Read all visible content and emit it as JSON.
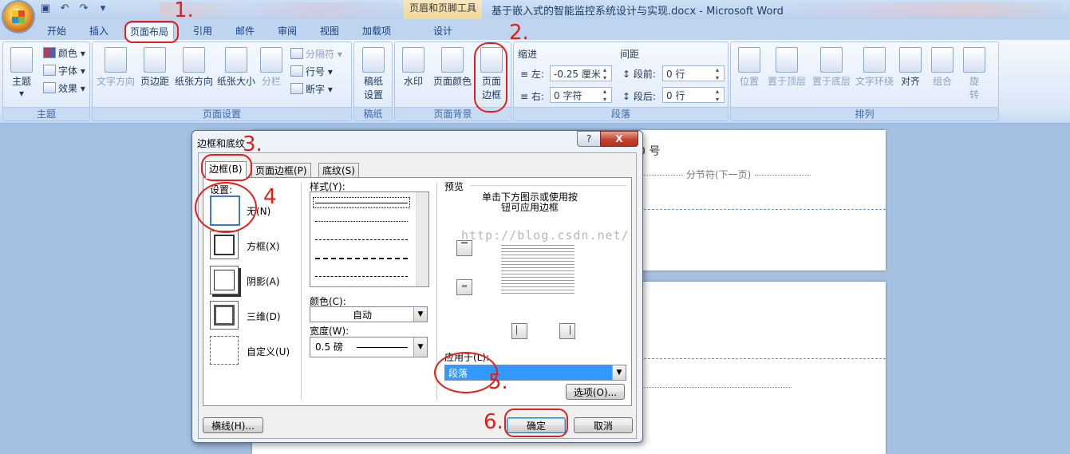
{
  "window": {
    "title": "基于嵌入式的智能监控系统设计与实现.docx - Microsoft Word",
    "context_tool": "页眉和页脚工具"
  },
  "tabs": [
    "开始",
    "插入",
    "页面布局",
    "引用",
    "邮件",
    "审阅",
    "视图",
    "加载项",
    "设计"
  ],
  "active_tab": "页面布局",
  "ribbon": {
    "theme": {
      "label": "主题",
      "btn_theme": "主题",
      "colors": "颜色",
      "fonts": "字体",
      "effects": "效果"
    },
    "page_setup": {
      "label": "页面设置",
      "text_dir": "文字方向",
      "margins": "页边距",
      "orientation": "纸张方向",
      "size": "纸张大小",
      "columns": "分栏",
      "breaks": "分隔符",
      "line_numbers": "行号",
      "hyphenation": "断字"
    },
    "draft": {
      "label": "稿纸",
      "btn": "稿纸设置"
    },
    "page_bg": {
      "label": "页面背景",
      "watermark": "水印",
      "page_color": "页面颜色",
      "page_borders": "页面边框"
    },
    "paragraph": {
      "label": "段落",
      "indent": "缩进",
      "spacing": "间距",
      "left": "左:",
      "left_val": "-0.25 厘米",
      "right": "右:",
      "right_val": "0 字符",
      "before": "段前:",
      "before_val": "0 行",
      "after": "段后:",
      "after_val": "0 行"
    },
    "arrange": {
      "label": "排列",
      "position": "位置",
      "bring_front": "置于顶层",
      "send_back": "置于底层",
      "wrap": "文字环绕",
      "align": "对齐",
      "group": "组合",
      "rotate": "旋转"
    }
  },
  "document": {
    "text_line": "0 号",
    "section_break": "分节符(下一页)"
  },
  "dialog": {
    "title": "边框和底纹",
    "help": "?",
    "close": "X",
    "tabs": [
      "边框(B)",
      "页面边框(P)",
      "底纹(S)"
    ],
    "settings_label": "设置:",
    "settings": [
      "无(N)",
      "方框(X)",
      "阴影(A)",
      "三维(D)",
      "自定义(U)"
    ],
    "style_label": "样式(Y):",
    "color_label": "颜色(C):",
    "color_value": "自动",
    "width_label": "宽度(W):",
    "width_value": "0.5 磅",
    "preview_label": "预览",
    "preview_hint": "单击下方图示或使用按钮可应用边框",
    "apply_label": "应用于(L):",
    "apply_value": "段落",
    "options_btn": "选项(O)...",
    "hline_btn": "横线(H)...",
    "ok": "确定",
    "cancel": "取消"
  },
  "watermark_url": "http://blog.csdn.net/",
  "annotations": [
    "1.",
    "2.",
    "3.",
    "4",
    "5.",
    "6."
  ],
  "colors": {
    "annotation": "#e0201c",
    "ribbon_bg": "#dbe8f8",
    "workspace": "#a6c0e1"
  }
}
